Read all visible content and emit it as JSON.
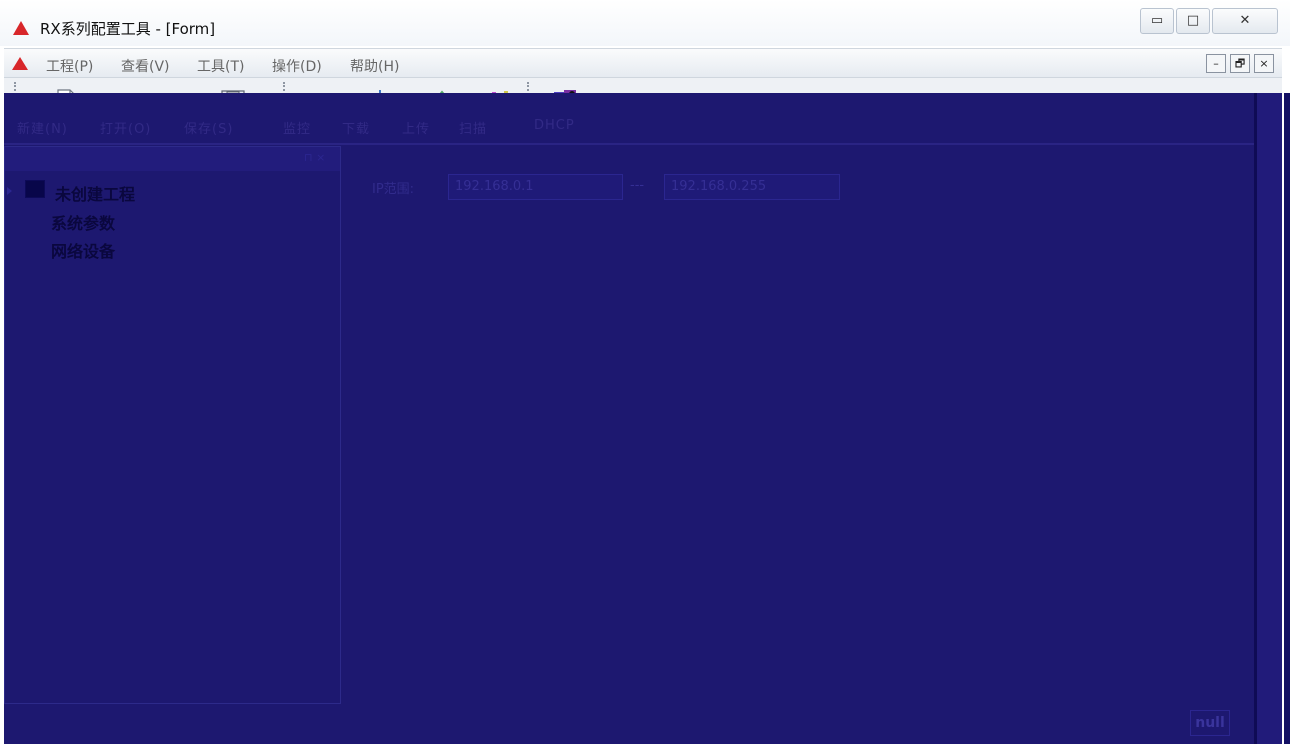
{
  "window": {
    "title": "RX系列配置工具 - [Form]",
    "min_label": "▭",
    "max_label": "□",
    "close_label": "✕"
  },
  "menubar": {
    "items": [
      {
        "label": "工程(P)"
      },
      {
        "label": "查看(V)"
      },
      {
        "label": "工具(T)"
      },
      {
        "label": "操作(D)"
      },
      {
        "label": "帮助(H)"
      }
    ],
    "mdi_min": "–",
    "mdi_restore": "🗗",
    "mdi_close": "×"
  },
  "toolbar": {
    "new_label": "新建(N)",
    "open_label": "打开(O)",
    "save_label": "保存(S)",
    "monitor_label": "监控",
    "download_label": "下载",
    "upload_label": "上传",
    "scan_label": "扫描",
    "dhcp_label": "DHCP",
    "icons": [
      "new-file-icon",
      "open-folder-icon",
      "save-disk-icon",
      "monitor-icon",
      "download-arrow-icon",
      "upload-arrow-icon",
      "scan-icon",
      "dhcp-icon"
    ]
  },
  "tree": {
    "root_label": "未创建工程",
    "children": [
      {
        "label": "系统参数"
      },
      {
        "label": "网络设备"
      }
    ]
  },
  "content": {
    "ip_label": "IP范围:",
    "ip_start": "192.168.0.1",
    "ip_dash": "---",
    "ip_end": "192.168.0.255"
  },
  "status": {
    "null_label": "null"
  },
  "colors": {
    "overlay_blue": "#1d1870",
    "logo_red": "#d8262a"
  }
}
